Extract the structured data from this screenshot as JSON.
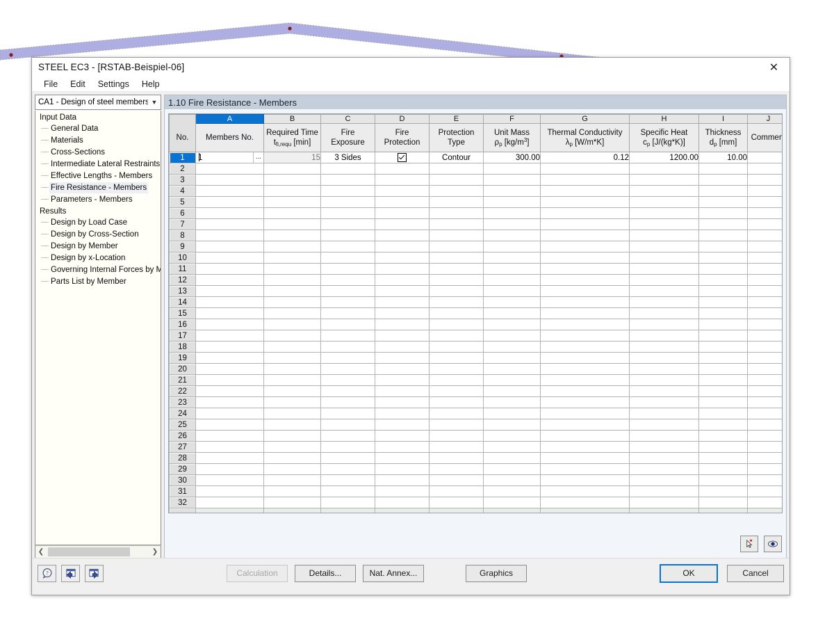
{
  "background": {
    "accent_color": "#a8a8e0",
    "node_color": "#8b1a1a",
    "outline_color": "#9a9a9a"
  },
  "window": {
    "title": "STEEL EC3 - [RSTAB-Beispiel-06]",
    "close_icon": "close-icon",
    "menu": [
      "File",
      "Edit",
      "Settings",
      "Help"
    ]
  },
  "sidebar": {
    "combo": {
      "value": "CA1 - Design of steel members",
      "arrow_icon": "chevron-down-icon"
    },
    "groups": [
      {
        "label": "Input Data",
        "items": [
          "General Data",
          "Materials",
          "Cross-Sections",
          "Intermediate Lateral Restraints",
          "Effective Lengths - Members",
          "Fire Resistance - Members",
          "Parameters - Members"
        ],
        "selected": "Fire Resistance - Members"
      },
      {
        "label": "Results",
        "items": [
          "Design by Load Case",
          "Design by Cross-Section",
          "Design by Member",
          "Design by x-Location",
          "Governing Internal Forces by M",
          "Parts List by Member"
        ],
        "selected": ""
      }
    ],
    "scrollbar": {
      "left_icon": "chevron-left-icon",
      "right_icon": "chevron-right-icon"
    }
  },
  "panel": {
    "title": "1.10 Fire Resistance - Members"
  },
  "grid": {
    "column_letters": [
      "",
      "A",
      "B",
      "C",
      "D",
      "E",
      "F",
      "G",
      "H",
      "I",
      "J"
    ],
    "selected_column": "A",
    "headers": [
      {
        "line1": "No.",
        "line2": ""
      },
      {
        "line1": "Members No.",
        "line2": ""
      },
      {
        "line1": "Required Time",
        "line2": "t fi,requ [min]"
      },
      {
        "line1": "Fire",
        "line2": "Exposure"
      },
      {
        "line1": "Fire",
        "line2": "Protection"
      },
      {
        "line1": "Protection",
        "line2": "Type"
      },
      {
        "line1": "Unit Mass",
        "line2": "ρ p [kg/m3]"
      },
      {
        "line1": "Thermal Conductivity",
        "line2": "λp [W/m*K]"
      },
      {
        "line1": "Specific Heat",
        "line2": "c p [J/(kg*K)]"
      },
      {
        "line1": "Thickness",
        "line2": "d p [mm]"
      },
      {
        "line1": "Comment",
        "line2": ""
      }
    ],
    "active_row": 1,
    "active_cell": {
      "value": "1",
      "ellipsis_label": "...",
      "ellipsis_icon": "ellipsis-button-icon"
    },
    "rows": [
      {
        "no": "1",
        "members_no": "1",
        "required_time": "15",
        "fire_exposure": "3 Sides",
        "fire_protection": true,
        "protection_type": "Contour",
        "unit_mass": "300.00",
        "thermal_conductivity": "0.12",
        "specific_heat": "1200.00",
        "thickness": "10.00",
        "comment": ""
      }
    ],
    "empty_row_numbers": [
      "2",
      "3",
      "4",
      "5",
      "6",
      "7",
      "8",
      "9",
      "10",
      "11",
      "12",
      "13",
      "14",
      "15",
      "16",
      "17",
      "18",
      "19",
      "20",
      "21",
      "22",
      "23",
      "24",
      "25",
      "26",
      "27",
      "28",
      "29",
      "30",
      "31",
      "32"
    ],
    "footer_buttons": [
      {
        "name": "pick-member-icon",
        "title": "Select"
      },
      {
        "name": "view-mode-icon",
        "title": "View"
      }
    ]
  },
  "footer": {
    "tool_buttons": [
      {
        "name": "help-icon",
        "title": "Help"
      },
      {
        "name": "previous-window-icon",
        "title": "Previous"
      },
      {
        "name": "next-window-icon",
        "title": "Next"
      }
    ],
    "calculation_label": "Calculation",
    "details_label": "Details...",
    "nat_annex_label": "Nat. Annex...",
    "graphics_label": "Graphics",
    "ok_label": "OK",
    "cancel_label": "Cancel"
  }
}
